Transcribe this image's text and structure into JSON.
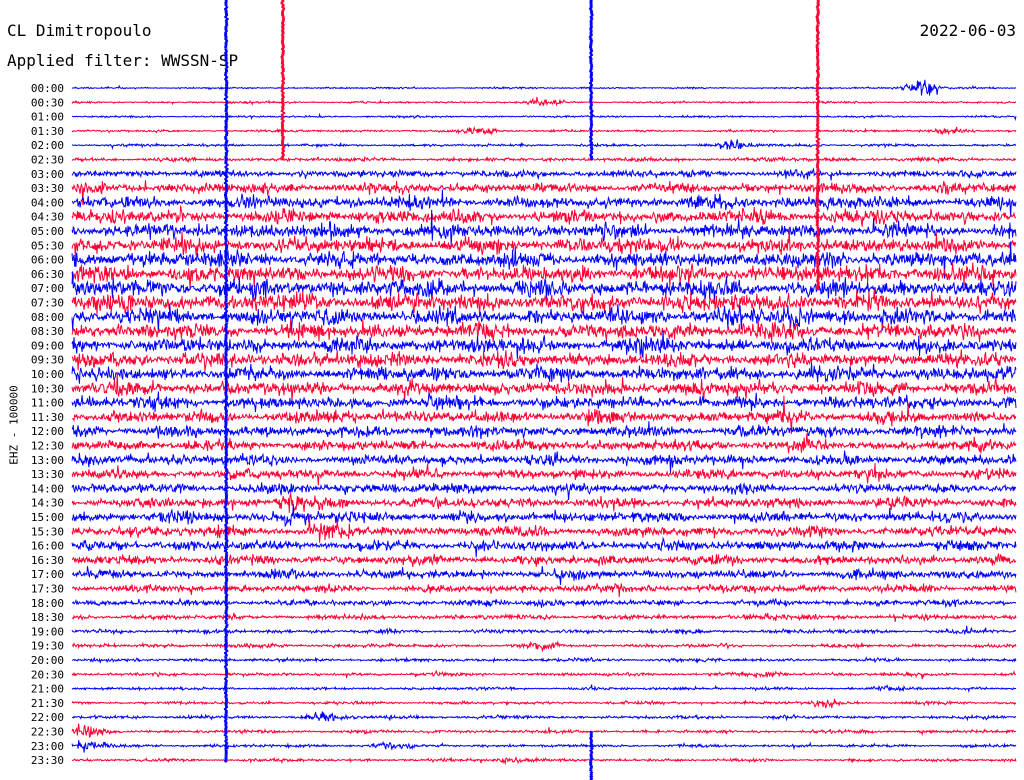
{
  "header": {
    "station": "CL Dimitropoulo",
    "filter": "Applied filter: WWSSN-SP",
    "date": "2022-06-03"
  },
  "chart_data": {
    "type": "line",
    "title": "CL Dimitropoulo",
    "subtitle": "Applied filter: WWSSN-SP",
    "date": "2022-06-03",
    "ylabel": "EHZ - 100000",
    "xlabel": "",
    "rows": [
      "00:00",
      "00:30",
      "01:00",
      "01:30",
      "02:00",
      "02:30",
      "03:00",
      "03:30",
      "04:00",
      "04:30",
      "05:00",
      "05:30",
      "06:00",
      "06:30",
      "07:00",
      "07:30",
      "08:00",
      "08:30",
      "09:00",
      "09:30",
      "10:00",
      "10:30",
      "11:00",
      "11:30",
      "12:00",
      "12:30",
      "13:00",
      "13:30",
      "14:00",
      "14:30",
      "15:00",
      "15:30",
      "16:00",
      "16:30",
      "17:00",
      "17:30",
      "18:00",
      "18:30",
      "19:00",
      "19:30",
      "20:00",
      "20:30",
      "21:00",
      "21:30",
      "22:00",
      "22:30",
      "23:00",
      "23:30"
    ],
    "colors": [
      "#0000ff",
      "#ff0033"
    ],
    "relative_noise_level": [
      0.5,
      0.6,
      0.6,
      0.7,
      0.8,
      1.2,
      2.2,
      3.2,
      3.8,
      4.4,
      4.6,
      4.8,
      5.0,
      5.2,
      5.4,
      5.4,
      5.2,
      5.0,
      4.8,
      4.6,
      4.4,
      4.2,
      4.0,
      3.8,
      3.6,
      3.4,
      3.2,
      3.0,
      3.1,
      3.2,
      3.3,
      3.3,
      3.2,
      3.0,
      2.8,
      2.4,
      1.8,
      1.5,
      1.2,
      1.1,
      1.0,
      1.0,
      0.9,
      0.9,
      1.0,
      1.0,
      0.9,
      0.9
    ],
    "events": [
      {
        "time": "00:00",
        "minute": 27,
        "amp": 6.0
      },
      {
        "time": "00:30",
        "minute": 15,
        "amp": 2.0
      },
      {
        "time": "01:30",
        "minute": 13,
        "amp": 2.0
      },
      {
        "time": "01:30",
        "minute": 28,
        "amp": 2.5
      },
      {
        "time": "02:00",
        "minute": 21,
        "amp": 3.0
      },
      {
        "time": "08:00",
        "minute": 23,
        "amp": 4.0
      },
      {
        "time": "14:30",
        "minute": 7,
        "amp": 3.0
      },
      {
        "time": "15:00",
        "minute": 7,
        "amp": 3.0
      },
      {
        "time": "15:30",
        "minute": 8,
        "amp": 3.0
      },
      {
        "time": "18:00",
        "minute": 15,
        "amp": 1.5
      },
      {
        "time": "18:30",
        "minute": 22,
        "amp": 1.8
      },
      {
        "time": "19:30",
        "minute": 15,
        "amp": 2.0
      },
      {
        "time": "20:30",
        "minute": 22,
        "amp": 1.5
      },
      {
        "time": "21:00",
        "minute": 26,
        "amp": 1.5
      },
      {
        "time": "21:30",
        "minute": 24,
        "amp": 2.0
      },
      {
        "time": "22:00",
        "minute": 8,
        "amp": 3.0
      },
      {
        "time": "22:30",
        "minute": 0.5,
        "amp": 4.0
      },
      {
        "time": "23:00",
        "minute": 0.5,
        "amp": 5.0
      },
      {
        "time": "23:00",
        "minute": 10,
        "amp": 2.0
      },
      {
        "time": "23:30",
        "minute": 14,
        "amp": 2.0
      }
    ],
    "spikes": [
      {
        "minute": 4.9,
        "from": "00:00",
        "to": "23:30",
        "up": true
      },
      {
        "minute": 6.7,
        "from": "00:00",
        "to": "02:30",
        "up": true
      },
      {
        "minute": 16.5,
        "from": "00:00",
        "to": "02:30",
        "up": true
      },
      {
        "minute": 23.7,
        "from": "00:00",
        "to": "07:00",
        "up": true
      },
      {
        "minute": 16.5,
        "from": "22:30",
        "to": "23:30",
        "up": false
      }
    ]
  }
}
